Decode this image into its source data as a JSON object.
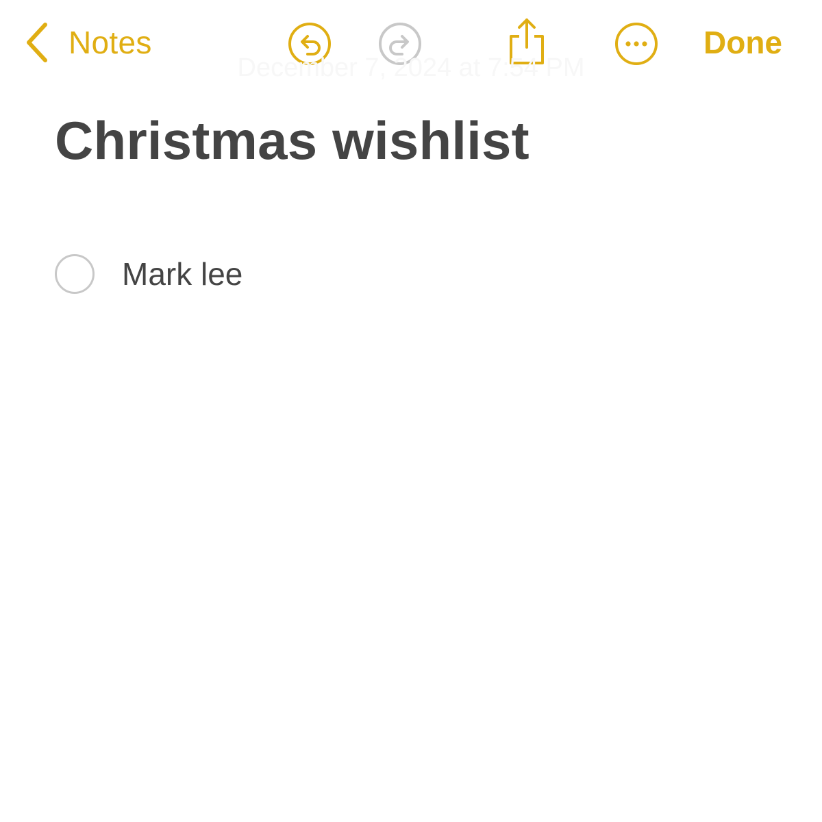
{
  "toolbar": {
    "back_label": "Notes",
    "done_label": "Done",
    "icons": {
      "back": "chevron-left-icon",
      "undo": "undo-icon",
      "redo": "redo-icon",
      "share": "share-icon",
      "more": "ellipsis-circle-icon"
    }
  },
  "note": {
    "date": "December 7, 2024 at 7:54 PM",
    "title": "Christmas wishlist",
    "checklist": [
      {
        "text": "Mark lee",
        "checked": false
      }
    ]
  },
  "colors": {
    "accent": "#e0ae13",
    "disabled": "#c8c8c8",
    "text": "#444444",
    "background": "#ffffff"
  }
}
